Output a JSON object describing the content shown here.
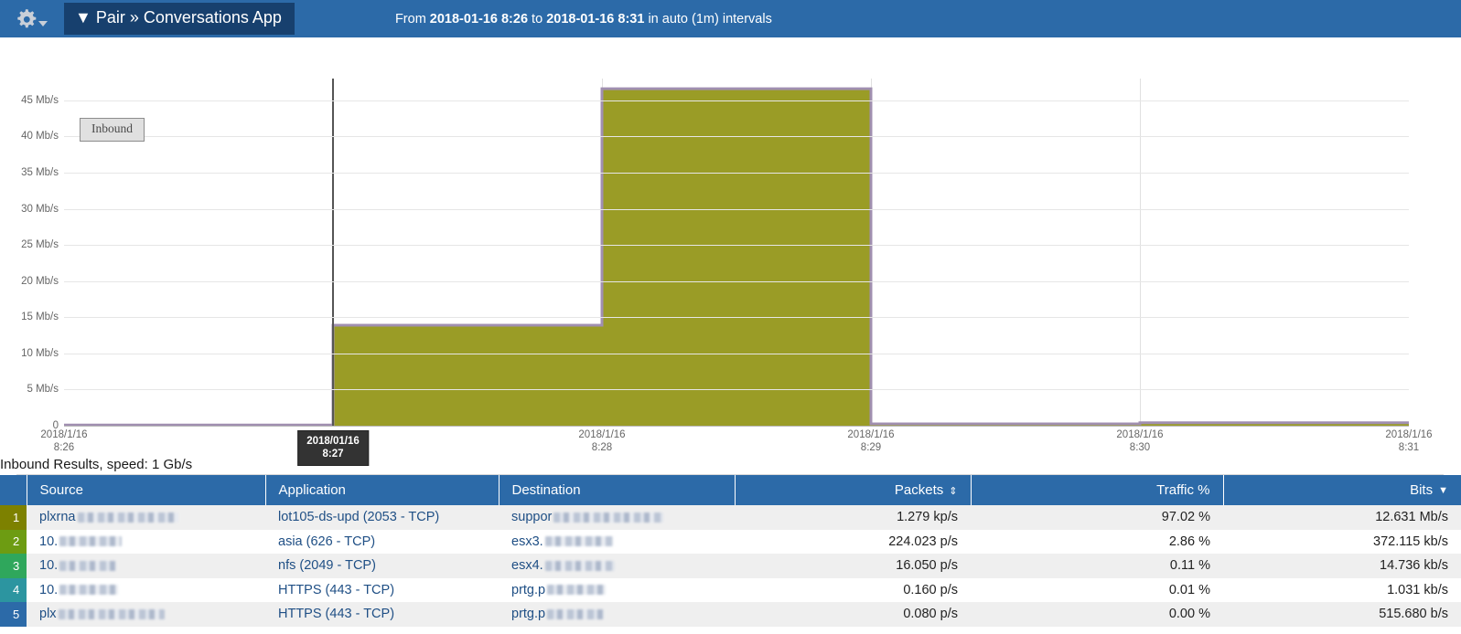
{
  "header": {
    "gear_icon": "gear-icon",
    "dropdown_icon": "chevron-down-icon",
    "title": "▼ Pair » Conversations App",
    "timerange_prefix": "From ",
    "timerange_from": "2018-01-16 8:26",
    "timerange_mid": " to ",
    "timerange_to": "2018-01-16 8:31",
    "timerange_suffix": " in auto (1m) intervals",
    "bar_color": "#2c6aa8",
    "pill_color": "#17406e"
  },
  "chart_data": {
    "type": "area",
    "title": "",
    "legend": [
      "Inbound"
    ],
    "legend_position": "top-left",
    "xlabel": "",
    "ylabel": "",
    "grid": true,
    "ylim": [
      0,
      48
    ],
    "yunit": "Mb/s",
    "ytick_labels": [
      "0",
      "5 Mb/s",
      "10 Mb/s",
      "15 Mb/s",
      "20 Mb/s",
      "25 Mb/s",
      "30 Mb/s",
      "35 Mb/s",
      "40 Mb/s",
      "45 Mb/s"
    ],
    "ytick_values": [
      0,
      5,
      10,
      15,
      20,
      25,
      30,
      35,
      40,
      45
    ],
    "xtick_labels": [
      "2018/1/16\n8:26",
      "2018/01/16\n8:27",
      "2018/1/16\n8:28",
      "2018/1/16\n8:29",
      "2018/1/16\n8:30",
      "2018/1/16\n8:31"
    ],
    "xticks": [
      {
        "line1": "2018/1/16",
        "line2": "8:26",
        "highlight": false
      },
      {
        "line1": "2018/01/16",
        "line2": "8:27",
        "highlight": true
      },
      {
        "line1": "2018/1/16",
        "line2": "8:28",
        "highlight": false
      },
      {
        "line1": "2018/1/16",
        "line2": "8:29",
        "highlight": false
      },
      {
        "line1": "2018/1/16",
        "line2": "8:30",
        "highlight": false
      },
      {
        "line1": "2018/1/16",
        "line2": "8:31",
        "highlight": false
      }
    ],
    "series": [
      {
        "name": "Inbound",
        "fill_color": "#9a9c26",
        "line_color": "#a08fb0",
        "x": [
          "8:26",
          "8:27",
          "8:28",
          "8:29",
          "8:30",
          "8:31"
        ],
        "values": [
          0.1,
          13.9,
          46.6,
          0.25,
          0.4,
          0.4
        ]
      }
    ]
  },
  "results": {
    "label": "Inbound Results, speed: 1 Gb/s",
    "columns": [
      {
        "key": "rank",
        "label": "",
        "align": "center",
        "sort": "none"
      },
      {
        "key": "source",
        "label": "Source",
        "align": "left",
        "sort": "none"
      },
      {
        "key": "app",
        "label": "Application",
        "align": "left",
        "sort": "none"
      },
      {
        "key": "dest",
        "label": "Destination",
        "align": "left",
        "sort": "none"
      },
      {
        "key": "packets",
        "label": "Packets",
        "align": "right",
        "sort": "both"
      },
      {
        "key": "traffic",
        "label": "Traffic %",
        "align": "right",
        "sort": "none"
      },
      {
        "key": "bits",
        "label": "Bits",
        "align": "right",
        "sort": "desc"
      }
    ],
    "sort_icons": {
      "both": "⇕",
      "desc": "▼"
    },
    "rows": [
      {
        "rank": "1",
        "rank_color": "#7d8100",
        "source_prefix": "plxrna",
        "source_redacted": true,
        "source_redact_w": 110,
        "app": "lot105-ds-upd (2053 - TCP)",
        "dest_prefix": "suppor",
        "dest_redacted": true,
        "dest_redact_w": 120,
        "packets": "1.279 kp/s",
        "traffic": "97.02 %",
        "bits": "12.631 Mb/s"
      },
      {
        "rank": "2",
        "rank_color": "#6d9c12",
        "source_prefix": "10.",
        "source_redacted": true,
        "source_redact_w": 68,
        "app": "asia (626 - TCP)",
        "dest_prefix": "esx3.",
        "dest_redacted": true,
        "dest_redact_w": 74,
        "packets": "224.023 p/s",
        "traffic": "2.86 %",
        "bits": "372.115 kb/s"
      },
      {
        "rank": "3",
        "rank_color": "#2fa75c",
        "source_prefix": "10.",
        "source_redacted": true,
        "source_redact_w": 62,
        "app": "nfs (2049 - TCP)",
        "dest_prefix": "esx4.",
        "dest_redacted": true,
        "dest_redact_w": 76,
        "packets": "16.050 p/s",
        "traffic": "0.11 %",
        "bits": "14.736 kb/s"
      },
      {
        "rank": "4",
        "rank_color": "#2c95a0",
        "source_prefix": "10.",
        "source_redacted": true,
        "source_redact_w": 64,
        "app": "HTTPS (443 - TCP)",
        "dest_prefix": "prtg.p",
        "dest_redacted": true,
        "dest_redact_w": 64,
        "packets": "0.160 p/s",
        "traffic": "0.01 %",
        "bits": "1.031 kb/s"
      },
      {
        "rank": "5",
        "rank_color": "#2c6aa8",
        "source_prefix": "plx",
        "source_redacted": true,
        "source_redact_w": 116,
        "app": "HTTPS (443 - TCP)",
        "dest_prefix": "prtg.p",
        "dest_redacted": true,
        "dest_redact_w": 62,
        "packets": "0.080 p/s",
        "traffic": "0.00 %",
        "bits": "515.680 b/s"
      }
    ]
  }
}
